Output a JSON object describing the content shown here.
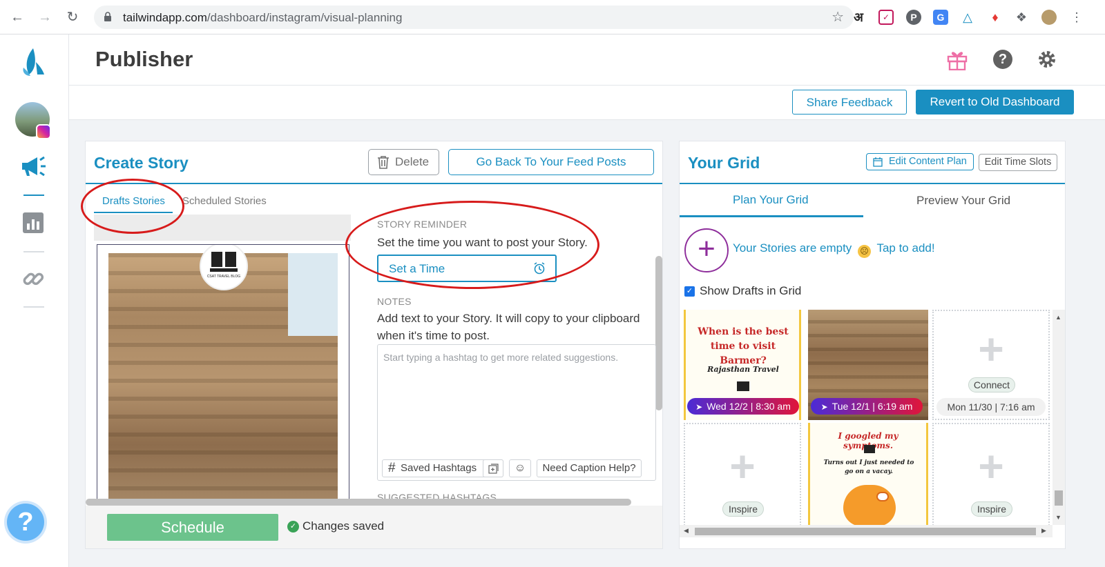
{
  "browser": {
    "url_host": "tailwindapp.com",
    "url_path": "/dashboard/instagram/visual-planning",
    "ext_hindi": "अ"
  },
  "header": {
    "title": "Publisher",
    "share_feedback": "Share Feedback",
    "revert": "Revert to Old Dashboard"
  },
  "create_story": {
    "title": "Create Story",
    "delete": "Delete",
    "go_back": "Go Back To Your Feed Posts",
    "tabs": [
      "Drafts Stories",
      "Scheduled Stories"
    ],
    "reminder_label": "STORY REMINDER",
    "reminder_text": "Set the time you want to post your Story.",
    "set_time": "Set a Time",
    "notes_label": "NOTES",
    "notes_text_1": "Add text to your Story. It will copy to your clipboard",
    "notes_text_2": "when it's time to post.",
    "notes_placeholder": "Start typing a hashtag to get more related suggestions.",
    "saved_hashtags": "Saved Hashtags",
    "caption_help": "Need Caption Help?",
    "suggested_label": "SUGGESTED HASHTAGS",
    "schedule": "Schedule",
    "changes_saved": "Changes saved",
    "logo_text": "CSAT TRAVEL BLOG"
  },
  "grid": {
    "title": "Your Grid",
    "edit_content_plan": "Edit Content Plan",
    "edit_time_slots": "Edit Time Slots",
    "tabs": [
      "Plan Your Grid",
      "Preview Your Grid"
    ],
    "stories_empty": "Your Stories are empty",
    "tap_to_add": "Tap to add!",
    "show_drafts": "Show Drafts in Grid",
    "show_drafts_checked": true,
    "tiles": [
      {
        "headline": "When is the best time to visit Barmer?",
        "sub": "Rajasthan Travel",
        "pill": "Wed 12/2 | 8:30 am"
      },
      {
        "pill": "Tue 12/1 | 6:19 am"
      },
      {
        "chip": "Connect",
        "time": "Mon 11/30 | 7:16 am"
      },
      {
        "chip": "Inspire"
      },
      {
        "headline": "I googled my symptoms.",
        "sub": "Turns out I just needed to go on a vacay."
      },
      {
        "chip": "Inspire"
      }
    ]
  },
  "colors": {
    "accent": "#1a8fc1",
    "annotation": "#d71b1b",
    "schedule_btn": "#6cc38c",
    "pill_start": "#4b2bd6",
    "pill_end": "#e0153a"
  },
  "icons": [
    "back-arrow-icon",
    "forward-arrow-icon",
    "reload-icon",
    "lock-icon",
    "star-icon",
    "tailwind-logo-icon",
    "instagram-badge-icon",
    "megaphone-icon",
    "analytics-icon",
    "link-icon",
    "help-icon",
    "gift-icon",
    "question-icon",
    "gear-icon",
    "trash-icon",
    "alarm-clock-icon",
    "hashtag-icon",
    "add-image-icon",
    "emoji-icon",
    "calendar-icon",
    "plus-circle-icon",
    "sad-face-icon",
    "check-circle-icon",
    "send-icon"
  ]
}
